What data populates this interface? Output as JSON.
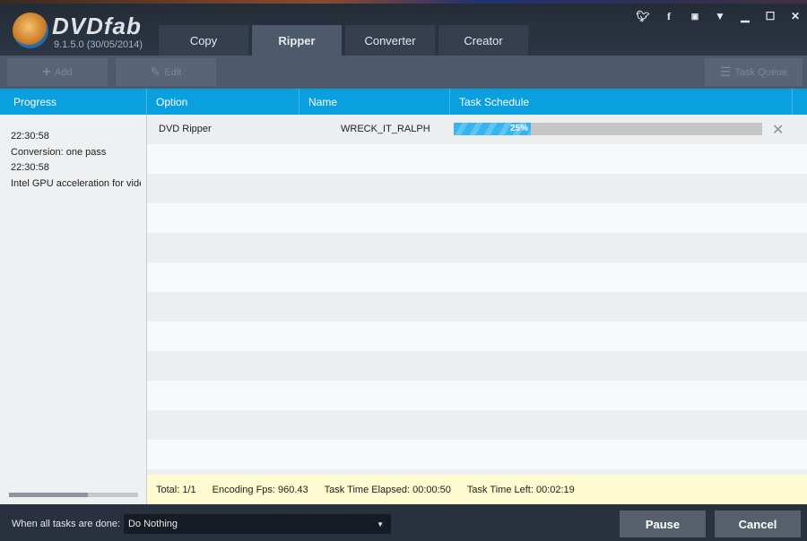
{
  "app": {
    "brand": "DVDfab",
    "version": "9.1.5.0 (30/05/2014)"
  },
  "tabs": [
    {
      "label": "Copy"
    },
    {
      "label": "Ripper"
    },
    {
      "label": "Converter"
    },
    {
      "label": "Creator"
    }
  ],
  "active_tab": "Ripper",
  "window_icons": [
    "twitter-icon",
    "facebook-icon",
    "youtube-icon",
    "dropdown-icon",
    "minimize-icon",
    "maximize-icon",
    "close-icon"
  ],
  "toolbar": {
    "add": "Add",
    "edit": "Edit",
    "task_queue": "Task Queue"
  },
  "columns": {
    "progress": "Progress",
    "option": "Option",
    "name": "Name",
    "schedule": "Task Schedule"
  },
  "log": [
    "22:30:58",
    "Conversion: one pass",
    "22:30:58",
    "Intel GPU acceleration for video"
  ],
  "tasks": [
    {
      "option": "DVD Ripper",
      "name": "WRECK_IT_RALPH",
      "progress": 25,
      "progress_label": "25%"
    }
  ],
  "footer": {
    "total": "Total: 1/1",
    "fps": "Encoding Fps: 960.43",
    "elapsed": "Task Time Elapsed: 00:00:50",
    "left": "Task Time Left: 00:02:19"
  },
  "bottom": {
    "when_done_label": "When all tasks are done:",
    "when_done_value": "Do Nothing",
    "pause": "Pause",
    "cancel": "Cancel"
  },
  "colors": {
    "accent": "#0aa0e0",
    "progress": "#39b3ef",
    "footer_bg": "#fefbd0"
  }
}
